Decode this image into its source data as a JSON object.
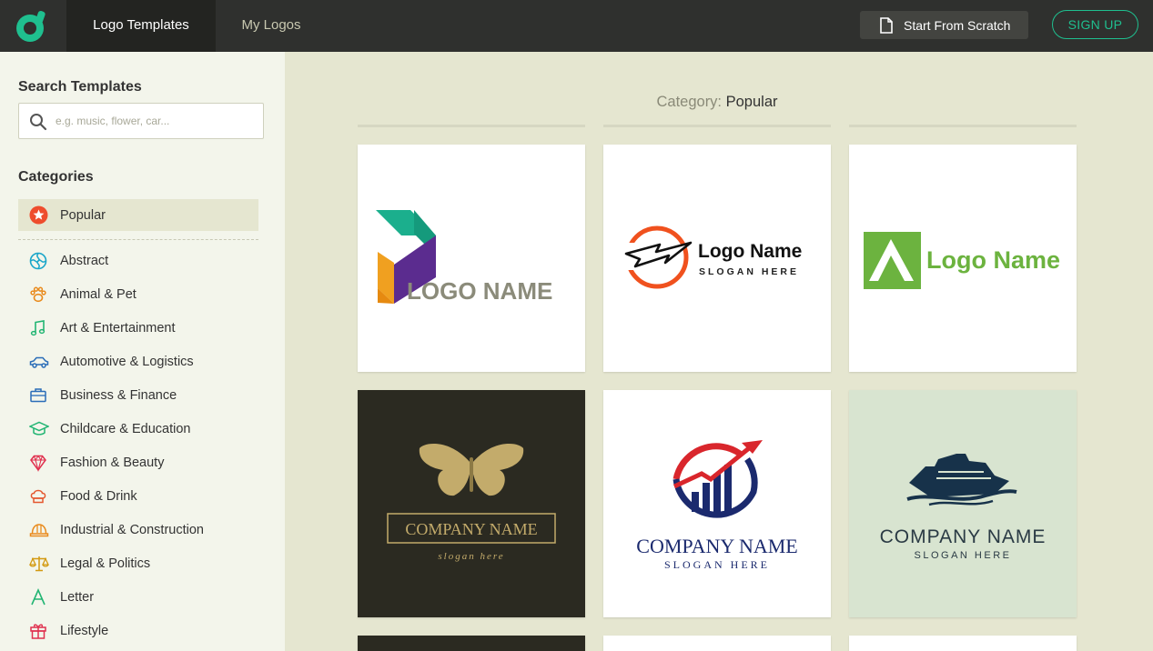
{
  "header": {
    "tabs": [
      {
        "label": "Logo Templates",
        "active": true
      },
      {
        "label": "My Logos",
        "active": false
      }
    ],
    "start_scratch_label": "Start From Scratch",
    "signup_label": "SIGN UP",
    "brand_color": "#1fbf8f"
  },
  "sidebar": {
    "search_title": "Search Templates",
    "search_placeholder": "e.g. music, flower, car...",
    "search_value": "",
    "categories_title": "Categories",
    "selected_category": {
      "label": "Popular",
      "icon": "star-icon"
    },
    "categories": [
      {
        "label": "Abstract",
        "icon": "abstract-swirl-icon"
      },
      {
        "label": "Animal & Pet",
        "icon": "paw-icon"
      },
      {
        "label": "Art & Entertainment",
        "icon": "music-note-icon"
      },
      {
        "label": "Automotive & Logistics",
        "icon": "car-icon"
      },
      {
        "label": "Business & Finance",
        "icon": "briefcase-icon"
      },
      {
        "label": "Childcare & Education",
        "icon": "graduation-cap-icon"
      },
      {
        "label": "Fashion & Beauty",
        "icon": "diamond-icon"
      },
      {
        "label": "Food & Drink",
        "icon": "chef-hat-icon"
      },
      {
        "label": "Industrial & Construction",
        "icon": "hard-hat-icon"
      },
      {
        "label": "Legal & Politics",
        "icon": "scales-icon"
      },
      {
        "label": "Letter",
        "icon": "letter-a-icon"
      },
      {
        "label": "Lifestyle",
        "icon": "gift-icon"
      }
    ]
  },
  "main": {
    "category_key": "Category:",
    "category_value": "Popular",
    "templates": [
      {
        "name": "LOGO NAME",
        "slogan": "",
        "logo": "ribbon-p-logo"
      },
      {
        "name": "Logo Name",
        "slogan": "SLOGAN HERE",
        "logo": "lightning-circle-logo"
      },
      {
        "name": "Logo Name",
        "slogan": "",
        "logo": "green-a-logo"
      },
      {
        "name": "COMPANY NAME",
        "slogan": "slogan here",
        "logo": "butterfly-logo"
      },
      {
        "name": "COMPANY NAME",
        "slogan": "SLOGAN HERE",
        "logo": "growth-chart-logo"
      },
      {
        "name": "COMPANY NAME",
        "slogan": "SLOGAN HERE",
        "logo": "cruise-ship-logo"
      }
    ]
  }
}
